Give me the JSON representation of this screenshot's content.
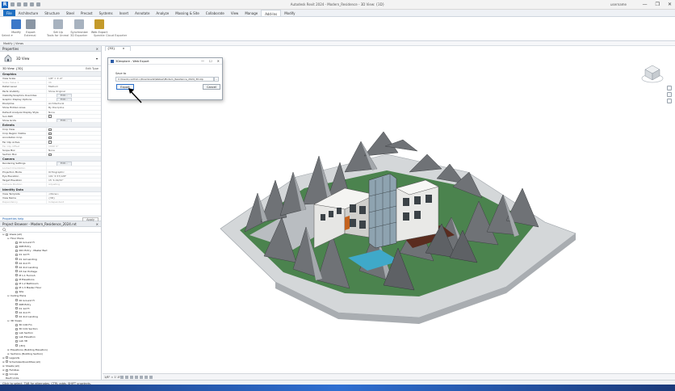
{
  "window": {
    "app_logo": "R",
    "title": "Autodesk Revit 2024 - Modern_Residence - 3D View: {3D}",
    "user": "username",
    "controls": [
      "—",
      "❐",
      "✕"
    ]
  },
  "ribbon": {
    "tabs": [
      "File",
      "Architecture",
      "Structure",
      "Steel",
      "Precast",
      "Systems",
      "Insert",
      "Annotate",
      "Analyze",
      "Massing & Site",
      "Collaborate",
      "View",
      "Manage",
      "Add-Ins",
      "Modify"
    ],
    "active_tab": "Add-Ins",
    "buttons": [
      {
        "label": "Modify",
        "color": "#3b78c9"
      },
      {
        "label": "Export",
        "color": "#8a96a4"
      },
      {
        "label": "Set Up",
        "color": "#a7b2bf"
      },
      {
        "label": "Synchronize",
        "color": "#a7b2bf"
      },
      {
        "label": "Web Export",
        "color": "#c49a2a"
      }
    ],
    "panel_labels": [
      "Select ▾",
      "External",
      "Tools for Unreal",
      "3D Exporter",
      "Speckle",
      "Cloud Exporter"
    ]
  },
  "modify_strip": {
    "label": "Modify | Views"
  },
  "properties": {
    "header": "Properties",
    "close": "×",
    "type_name": "3D View",
    "instance_label": "3D View: {3D}",
    "edit_type": "Edit Type",
    "sections": [
      {
        "title": "Graphics",
        "rows": [
          {
            "k": "View Scale",
            "v": "1/8\" = 1'-0\""
          },
          {
            "k": "Scale Value 1:",
            "v": "96",
            "dim": true
          },
          {
            "k": "Detail Level",
            "v": "Medium"
          },
          {
            "k": "Parts Visibility",
            "v": "Show Original"
          },
          {
            "k": "Visibility/Graphics Overrides",
            "v": "",
            "button": "Edit..."
          },
          {
            "k": "Graphic Display Options",
            "v": "",
            "button": "Edit..."
          },
          {
            "k": "Discipline",
            "v": "Architectural"
          },
          {
            "k": "Show Hidden Lines",
            "v": "By Discipline"
          },
          {
            "k": "Default Analysis Display Style",
            "v": "None"
          },
          {
            "k": "Sun Path",
            "v": "",
            "checkbox": true
          },
          {
            "k": "Show Grids",
            "v": "",
            "button": "Edit..."
          }
        ]
      },
      {
        "title": "Extents",
        "rows": [
          {
            "k": "Crop View",
            "v": "",
            "checkbox": true
          },
          {
            "k": "Crop Region Visible",
            "v": "",
            "checkbox": true
          },
          {
            "k": "Annotation Crop",
            "v": "",
            "checkbox": true
          },
          {
            "k": "Far Clip Active",
            "v": "",
            "checkbox": true
          },
          {
            "k": "Far Clip Offset",
            "v": "1000' 0\"",
            "dim": true
          },
          {
            "k": "Scope Box",
            "v": "None"
          },
          {
            "k": "Section Box",
            "v": "",
            "checkbox": true
          }
        ]
      },
      {
        "title": "Camera",
        "rows": [
          {
            "k": "Rendering Settings",
            "v": "",
            "button": "Edit..."
          },
          {
            "k": "Locked Orientation",
            "v": "",
            "dim": true
          },
          {
            "k": "Projection Mode",
            "v": "Orthographic"
          },
          {
            "k": "Eye Elevation",
            "v": "101' 6 57/128\""
          },
          {
            "k": "Target Elevation",
            "v": "15' 6 19/32\""
          },
          {
            "k": "Camera Position",
            "v": "Adjusting",
            "dim": true
          }
        ]
      },
      {
        "title": "Identity Data",
        "rows": [
          {
            "k": "View Template",
            "v": "<None>"
          },
          {
            "k": "View Name",
            "v": "{3D}"
          },
          {
            "k": "Dependency",
            "v": "Independent",
            "dim": true
          }
        ]
      }
    ],
    "help_link": "Properties help",
    "apply": "Apply"
  },
  "project_browser": {
    "header": "Project Browser - Modern_Residence_2024.rvt",
    "close": "×",
    "items": [
      {
        "indent": 0,
        "tw": "⊟",
        "cb": true,
        "label": "Views (all)"
      },
      {
        "indent": 1,
        "tw": "⊟",
        "cb": false,
        "label": "Floor Plans"
      },
      {
        "indent": 2,
        "tw": "",
        "cb": true,
        "label": "00 Ground Fl"
      },
      {
        "indent": 2,
        "tw": "",
        "cb": true,
        "label": "00B Entry"
      },
      {
        "indent": 2,
        "tw": "",
        "cb": true,
        "label": "00C Entry - Master Bed"
      },
      {
        "indent": 2,
        "tw": "",
        "cb": true,
        "label": "01 1st Fl"
      },
      {
        "indent": 2,
        "tw": "",
        "cb": true,
        "label": "01 1st Landing"
      },
      {
        "indent": 2,
        "tw": "",
        "cb": true,
        "label": "02 2nd Fl"
      },
      {
        "indent": 2,
        "tw": "",
        "cb": true,
        "label": "02 2nd Landing"
      },
      {
        "indent": 2,
        "tw": "",
        "cb": true,
        "label": "03 Car Portage"
      },
      {
        "indent": 2,
        "tw": "",
        "cb": true,
        "label": "M 1.1 Furnish"
      },
      {
        "indent": 2,
        "tw": "",
        "cb": true,
        "label": "M Elevations"
      },
      {
        "indent": 2,
        "tw": "",
        "cb": true,
        "label": "M 1.2 Bathroom"
      },
      {
        "indent": 2,
        "tw": "",
        "cb": true,
        "label": "M 1.3 Master Floor"
      },
      {
        "indent": 2,
        "tw": "",
        "cb": true,
        "label": "Site"
      },
      {
        "indent": 1,
        "tw": "⊟",
        "cb": false,
        "label": "Ceiling Plans"
      },
      {
        "indent": 2,
        "tw": "",
        "cb": true,
        "label": "00 Ground Fl"
      },
      {
        "indent": 2,
        "tw": "",
        "cb": true,
        "label": "00B Entry"
      },
      {
        "indent": 2,
        "tw": "",
        "cb": true,
        "label": "01 1st Fl"
      },
      {
        "indent": 2,
        "tw": "",
        "cb": true,
        "label": "02 2nd Fl"
      },
      {
        "indent": 2,
        "tw": "",
        "cb": true,
        "label": "02 2nd Landing"
      },
      {
        "indent": 1,
        "tw": "⊟",
        "cb": false,
        "label": "3D Views"
      },
      {
        "indent": 2,
        "tw": "",
        "cb": true,
        "label": "3D 100 Fin"
      },
      {
        "indent": 2,
        "tw": "",
        "cb": true,
        "label": "3D 101 Section"
      },
      {
        "indent": 2,
        "tw": "",
        "cb": true,
        "label": "Lab Section"
      },
      {
        "indent": 2,
        "tw": "",
        "cb": true,
        "label": "Lab Elevation"
      },
      {
        "indent": 2,
        "tw": "",
        "cb": true,
        "label": "Lab 3D"
      },
      {
        "indent": 2,
        "tw": "",
        "cb": true,
        "label": "{3D}"
      },
      {
        "indent": 1,
        "tw": "⊞",
        "cb": false,
        "label": "Elevations (Building Elevation)"
      },
      {
        "indent": 1,
        "tw": "⊞",
        "cb": false,
        "label": "Sections (Building Section)"
      },
      {
        "indent": 0,
        "tw": "⊞",
        "cb": true,
        "label": "Legends"
      },
      {
        "indent": 0,
        "tw": "⊞",
        "cb": true,
        "label": "Schedules/Quantities (all)"
      },
      {
        "indent": 0,
        "tw": "⊞",
        "cb": false,
        "label": "Sheets (all)"
      },
      {
        "indent": 0,
        "tw": "⊞",
        "cb": true,
        "label": "Families"
      },
      {
        "indent": 0,
        "tw": "⊞",
        "cb": true,
        "label": "Groups"
      },
      {
        "indent": 0,
        "tw": "",
        "cb": false,
        "label": "Revit Links"
      }
    ]
  },
  "view": {
    "tab_label": "{3D}",
    "tab_close": "×",
    "scale": "1/8\" = 1'-0\""
  },
  "dialog": {
    "title": "3Dexplore - Web Export",
    "controls": [
      "—",
      "☐",
      "✕"
    ],
    "save_label": "Save to",
    "path": "C:\\Users\\<admin>\\Downloads\\Webex\\Modern_Residence_2024_3D.zip",
    "browse": "...",
    "export": "Export",
    "cancel": "Cancel"
  },
  "status": {
    "message": "Click to select, TAB for alternates, CTRL adds, SHIFT unselects."
  },
  "colors": {
    "accent": "#1f6fc1",
    "ground": "#3c7a3e",
    "terrain": "#cfd2d4",
    "rock": "#6f7276",
    "deck": "#5a2c1f",
    "water": "#3fa9c9"
  }
}
